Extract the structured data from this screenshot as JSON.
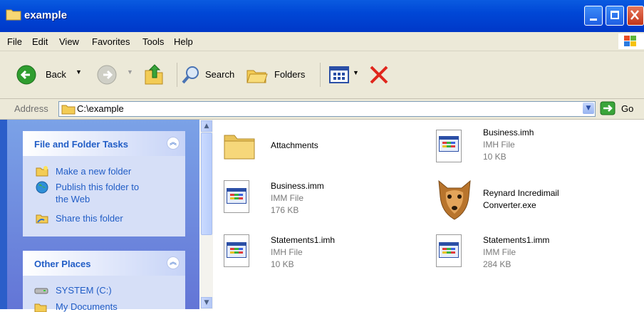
{
  "window": {
    "title": "example"
  },
  "menu": [
    "File",
    "Edit",
    "View",
    "Favorites",
    "Tools",
    "Help"
  ],
  "toolbar": {
    "back": "Back",
    "search": "Search",
    "folders": "Folders"
  },
  "address": {
    "label": "Address",
    "value": "C:\\example",
    "go": "Go"
  },
  "tasks_panel": {
    "title": "File and Folder Tasks",
    "items": [
      "Make a new folder",
      "Publish this folder to",
      "the Web",
      "Share this folder"
    ]
  },
  "places_panel": {
    "title": "Other Places",
    "items": [
      "SYSTEM (C:)",
      "My Documents"
    ]
  },
  "files": [
    {
      "name": "Attachments",
      "type": "",
      "size": ""
    },
    {
      "name": "Business.imh",
      "type": "IMH File",
      "size": "10 KB"
    },
    {
      "name": "Business.imm",
      "type": "IMM File",
      "size": "176 KB"
    },
    {
      "name": "Reynard Incredimail",
      "name2": "Converter.exe",
      "type": "",
      "size": ""
    },
    {
      "name": "Statements1.imh",
      "type": "IMH File",
      "size": "10 KB"
    },
    {
      "name": "Statements1.imm",
      "type": "IMM File",
      "size": "284 KB"
    }
  ]
}
